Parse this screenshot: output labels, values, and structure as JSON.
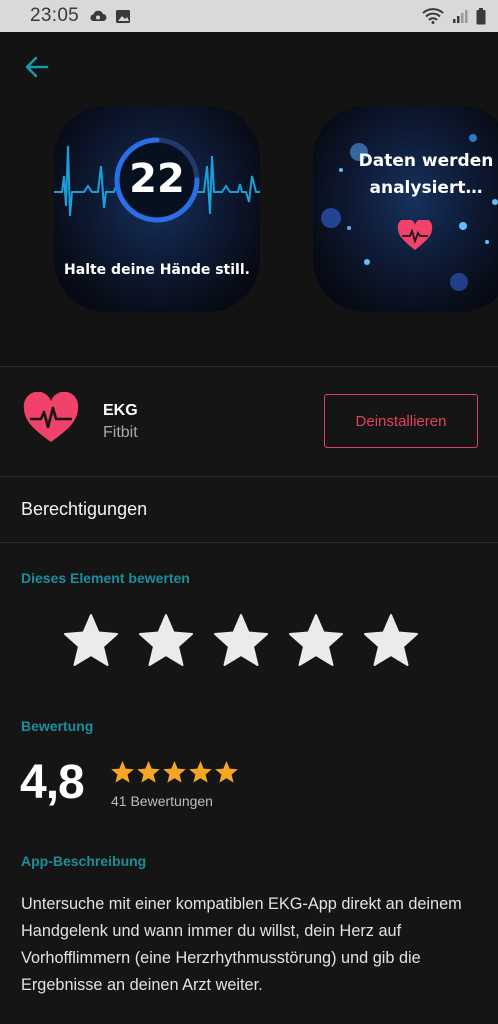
{
  "status_bar": {
    "time": "23:05"
  },
  "hero": {
    "timer_value": "22",
    "timer_caption": "Halte deine Hände still.",
    "analysis_line1": "Daten werden",
    "analysis_line2": "analysiert…"
  },
  "app": {
    "name": "EKG",
    "developer": "Fitbit",
    "uninstall_label": "Deinstallieren"
  },
  "permissions_label": "Berechtigungen",
  "rate_section": {
    "label": "Dieses Element bewerten",
    "star_count": 5
  },
  "rating": {
    "label": "Bewertung",
    "value": "4,8",
    "stars_filled": 5,
    "count": "41 Bewertungen"
  },
  "description": {
    "label": "App-Beschreibung",
    "text": "Untersuche mit einer kompatiblen EKG-App direkt an deinem Handgelenk und wann immer du willst, dein Herz auf Vorhofflimmern (eine Herzrhythmusstörung) und gib die Ergebnisse an deinen Arzt weiter."
  },
  "colors": {
    "accent_teal": "#1b8e9c",
    "uninstall_red": "#e0415e",
    "star_gold": "#f5a623",
    "heart_pink": "#f0426a"
  }
}
